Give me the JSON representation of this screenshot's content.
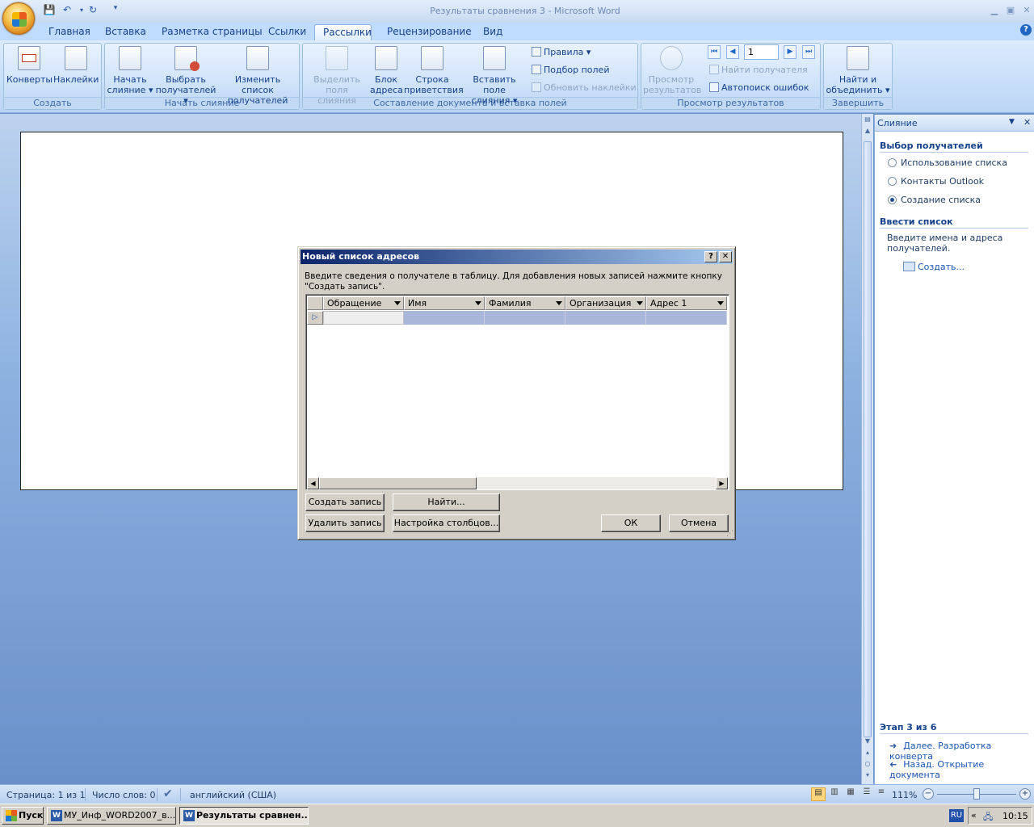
{
  "window": {
    "title": "Результаты сравнения 3 - Microsoft Word"
  },
  "tabs": [
    "Главная",
    "Вставка",
    "Разметка страницы",
    "Ссылки",
    "Рассылки",
    "Рецензирование",
    "Вид"
  ],
  "active_tab": "Рассылки",
  "ribbon": {
    "groups": {
      "create": "Создать",
      "start": "Начать слияние",
      "compose": "Составление документа и вставка полей",
      "preview": "Просмотр результатов",
      "finish": "Завершить"
    },
    "envelopes": "Конверты",
    "labels": "Наклейки",
    "start_merge": [
      "Начать",
      "слияние ▾"
    ],
    "select_recipients": [
      "Выбрать",
      "получателей ▾"
    ],
    "edit_list": [
      "Изменить список",
      "получателей"
    ],
    "highlight_fields": [
      "Выделить",
      "поля слияния"
    ],
    "address_block": [
      "Блок",
      "адреса"
    ],
    "greeting_line": [
      "Строка",
      "приветствия"
    ],
    "insert_field": [
      "Вставить поле",
      "слияния ▾"
    ],
    "rules": "Правила ▾",
    "match_fields": "Подбор полей",
    "update_labels": "Обновить наклейки",
    "preview_results": [
      "Просмотр",
      "результатов"
    ],
    "record_value": "1",
    "find_recipient": "Найти получателя",
    "auto_check": "Автопоиск ошибок",
    "finish_merge": [
      "Найти и",
      "объединить ▾"
    ]
  },
  "taskpane": {
    "title": "Слияние",
    "section1": "Выбор получателей",
    "options": [
      "Использование списка",
      "Контакты Outlook",
      "Создание списка"
    ],
    "selected_option": 2,
    "section2": "Ввести список",
    "hint": [
      "Введите имена и адреса",
      "получателей."
    ],
    "create_link": "Создать...",
    "step": "Этап 3 из 6",
    "next": "Далее. Разработка конверта",
    "back": "Назад. Открытие документа"
  },
  "dialog": {
    "title": "Новый список адресов",
    "help": "?",
    "close": "✕",
    "description": "Введите сведения о получателе в таблицу. Для добавления новых записей нажмите кнопку \"Создать запись\".",
    "columns": [
      "Обращение",
      "Имя",
      "Фамилия",
      "Организация",
      "Адрес 1"
    ],
    "buttons": {
      "new_entry": "Создать запись",
      "find": "Найти...",
      "delete_entry": "Удалить запись",
      "customize": "Настройка столбцов...",
      "ok": "ОК",
      "cancel": "Отмена"
    }
  },
  "status": {
    "page": "Страница: 1 из 1",
    "words": "Число слов: 0",
    "language": "английский (США)",
    "zoom": "111%"
  },
  "taskbar": {
    "start": "Пуск",
    "items": [
      "МУ_Инф_WORD2007_в...",
      "Результаты сравнен..."
    ],
    "lang": "RU",
    "time": "10:15"
  }
}
